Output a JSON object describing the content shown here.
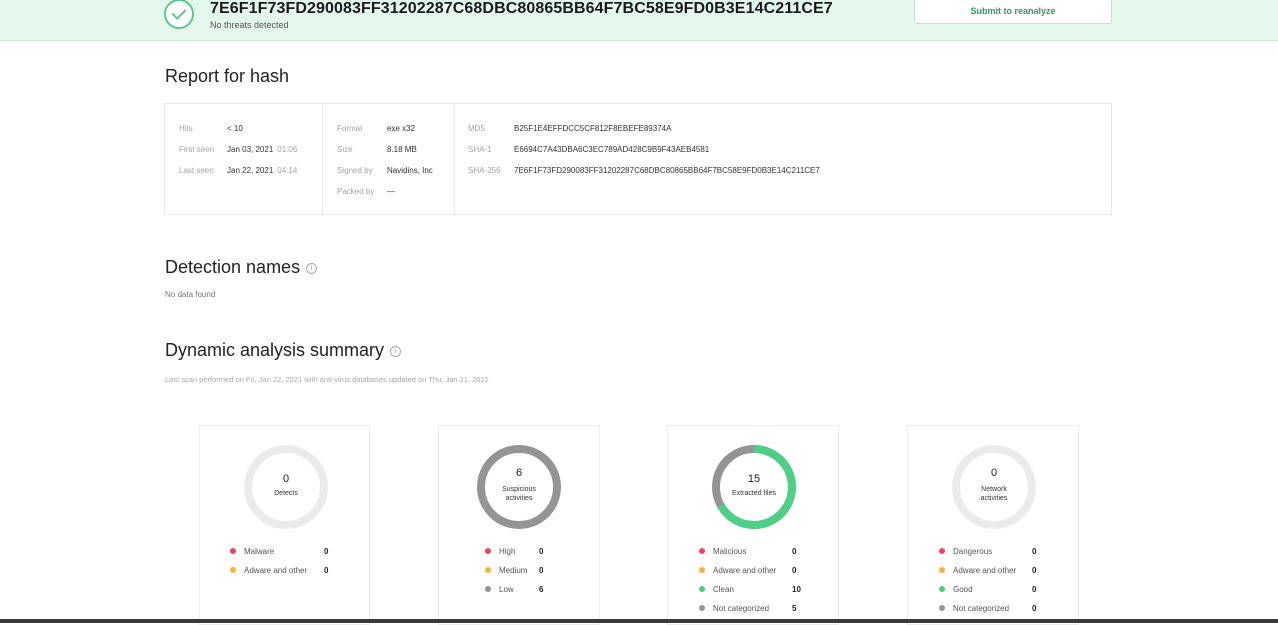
{
  "banner": {
    "hash": "7E6F1F73FD290083FF31202287C68DBC80865BB64F7BC58E9FD0B3E14C211CE7",
    "status": "No threats detected",
    "reanalyze_label": "Submit to reanalyze",
    "accent_color": "#5cc98c"
  },
  "report": {
    "title": "Report for hash",
    "col1": [
      {
        "key": "Hits",
        "value": "< 10",
        "time": ""
      },
      {
        "key": "First seen",
        "value": "Jan 03, 2021",
        "time": "01:06"
      },
      {
        "key": "Last seen",
        "value": "Jan 22, 2021",
        "time": "04:14"
      }
    ],
    "col2": [
      {
        "key": "Format",
        "value": "exe x32"
      },
      {
        "key": "Size",
        "value": "8.18 MB"
      },
      {
        "key": "Signed by",
        "value": "Navidins, Inc"
      },
      {
        "key": "Packed by",
        "value": "—"
      }
    ],
    "col3": [
      {
        "key": "MD5",
        "value": "B25F1E4EFFDCC5CF812F8EBEFE89374A"
      },
      {
        "key": "SHA-1",
        "value": "E6694C7A43DBA6C3EC789AD428C9B9F43AEB4581"
      },
      {
        "key": "SHA-256",
        "value": "7E6F1F73FD290083FF31202287C68DBC80865BB64F7BC58E9FD0B3E14C211CE7"
      }
    ]
  },
  "detection": {
    "title": "Detection names",
    "empty_text": "No data found"
  },
  "dynamic": {
    "title": "Dynamic analysis summary",
    "last_scan": "Last scan performed on Fri, Jan 22, 2021 with anti-virus databases updated on Thu, Jan 21, 2021",
    "tiles": [
      {
        "count": "0",
        "label_line1": "Detects",
        "label_line2": "",
        "ring_color": "#ebebeb",
        "ring_fraction": 0,
        "legend": [
          {
            "label": "Malware",
            "count": "0",
            "color": "#f0425f"
          },
          {
            "label": "Adware and other",
            "count": "0",
            "color": "#f4b533"
          }
        ]
      },
      {
        "count": "6",
        "label_line1": "Suspicious",
        "label_line2": "activities",
        "ring_color": "#949494",
        "ring_fraction": 1,
        "legend": [
          {
            "label": "High",
            "count": "0",
            "color": "#f0425f"
          },
          {
            "label": "Medium",
            "count": "0",
            "color": "#f4b533"
          },
          {
            "label": "Low",
            "count": "6",
            "color": "#949494"
          }
        ]
      },
      {
        "count": "15",
        "label_line1": "Extracted files",
        "label_line2": "",
        "ring_color": "#4ccf86",
        "ring_base_color": "#949494",
        "ring_fraction": 0.667,
        "legend": [
          {
            "label": "Malicious",
            "count": "0",
            "color": "#f0425f"
          },
          {
            "label": "Adware and other",
            "count": "0",
            "color": "#f4b533"
          },
          {
            "label": "Clean",
            "count": "10",
            "color": "#4ccf86"
          },
          {
            "label": "Not categorized",
            "count": "5",
            "color": "#949494"
          }
        ]
      },
      {
        "count": "0",
        "label_line1": "Network",
        "label_line2": "activities",
        "ring_color": "#ebebeb",
        "ring_fraction": 0,
        "legend": [
          {
            "label": "Dangerous",
            "count": "0",
            "color": "#f0425f"
          },
          {
            "label": "Adware and other",
            "count": "0",
            "color": "#f4b533"
          },
          {
            "label": "Good",
            "count": "0",
            "color": "#4ccf86"
          },
          {
            "label": "Not categorized",
            "count": "0",
            "color": "#949494"
          }
        ]
      }
    ]
  }
}
